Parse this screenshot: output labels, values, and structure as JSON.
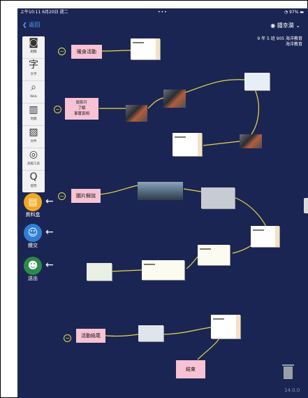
{
  "status_bar": {
    "time": "上午10:11 6月20日 週二",
    "dots": "•••",
    "battery": "97%"
  },
  "header": {
    "back_label": "返回",
    "user_name": "鍾幸潤",
    "class_line1": "9 年 5 班 905 海洋教育",
    "class_line2": "海洋教育"
  },
  "toolbar": {
    "items": [
      {
        "icon": "camera-icon",
        "label": "相機"
      },
      {
        "icon": "text-icon",
        "glyph": "字",
        "label": "文字"
      },
      {
        "icon": "web-icon",
        "label": "Web"
      },
      {
        "icon": "map-icon",
        "label": "地圖"
      },
      {
        "icon": "file-icon",
        "label": "文件"
      },
      {
        "icon": "assist-tools-icon",
        "label": "高級工具"
      },
      {
        "icon": "quiz-icon",
        "glyph": "Q",
        "label": "提問"
      }
    ]
  },
  "side_actions": {
    "box": "資料盒",
    "submit": "繳交",
    "send": "送出"
  },
  "nodes": {
    "warmup": "暖身活動",
    "video": "說影片\n了解\n事實真相",
    "image_explain": "圖片解說",
    "end_activity": "活動結尾",
    "end": "結束"
  },
  "footer": {
    "version": "14.0.0"
  },
  "colors": {
    "background": "#1b2553",
    "node": "#f7c3d4",
    "connector": "#e6d94a",
    "accent": "#5aa9ff"
  }
}
